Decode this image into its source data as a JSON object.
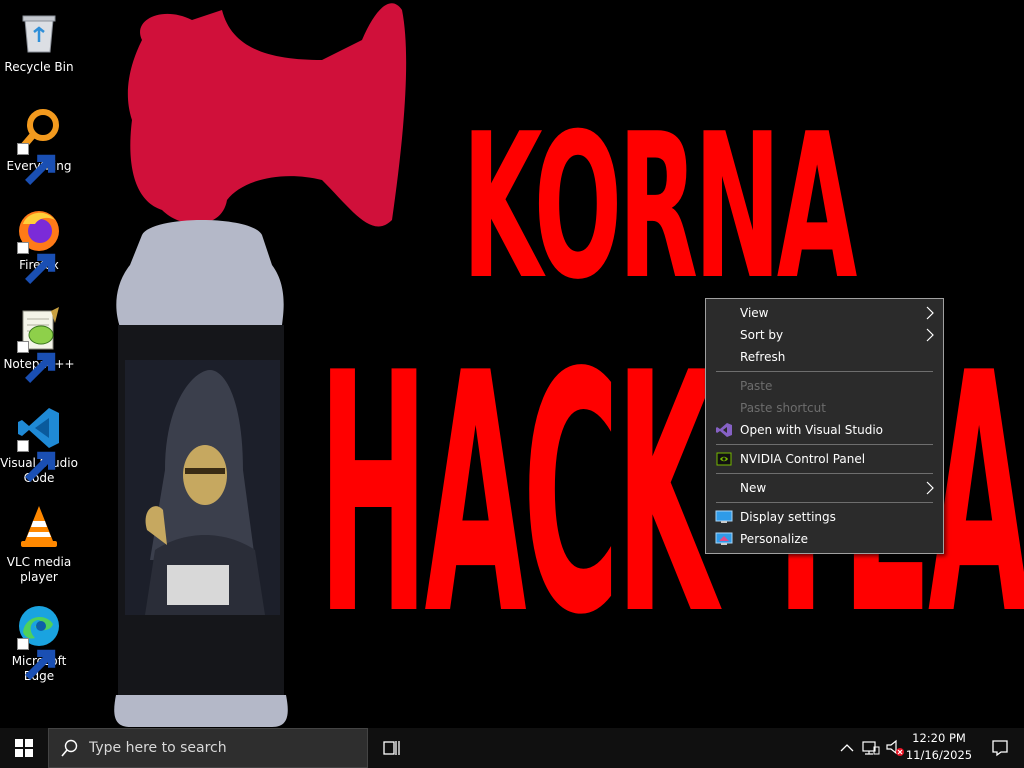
{
  "desktop": {
    "icons": [
      {
        "label": "Recycle Bin",
        "icon": "recycle-bin-icon"
      },
      {
        "label": "Everything",
        "icon": "everything-search-icon"
      },
      {
        "label": "Firefox",
        "icon": "firefox-icon"
      },
      {
        "label": "Notepad++",
        "icon": "notepad-plus-plus-icon"
      },
      {
        "label": "Visual Studio Code",
        "icon": "vscode-icon"
      },
      {
        "label": "VLC media player",
        "icon": "vlc-icon"
      },
      {
        "label": "Microsoft Edge",
        "icon": "edge-icon"
      }
    ],
    "wallpaper": {
      "line1": "KORNA",
      "line2": "HACK TEAM",
      "text_color": "#ff0000"
    }
  },
  "context_menu": {
    "items": [
      {
        "label": "View",
        "submenu": true
      },
      {
        "label": "Sort by",
        "submenu": true
      },
      {
        "label": "Refresh"
      },
      {
        "label": "Paste",
        "disabled": true
      },
      {
        "label": "Paste shortcut",
        "disabled": true
      },
      {
        "label": "Open with Visual Studio",
        "icon": "visual-studio-icon"
      },
      {
        "label": "NVIDIA Control Panel",
        "icon": "nvidia-icon"
      },
      {
        "label": "New",
        "submenu": true
      },
      {
        "label": "Display settings",
        "icon": "display-settings-icon"
      },
      {
        "label": "Personalize",
        "icon": "personalize-icon"
      }
    ]
  },
  "taskbar": {
    "search_placeholder": "Type here to search",
    "clock": {
      "time": "12:20 PM",
      "date": "11/16/2025"
    }
  },
  "colors": {
    "menu_bg": "#2b2b2b",
    "taskbar_bg": "#101010",
    "horn_red": "#d0103a",
    "accent_blue": "#0078d4"
  }
}
